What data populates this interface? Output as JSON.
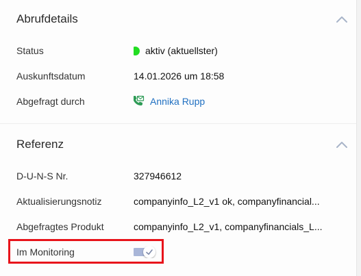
{
  "colors": {
    "status_active": "#22dd22",
    "link": "#1f6fc1",
    "highlight": "#e8141b",
    "toggle_track": "#a9b6d8",
    "toggle_check": "#7d88a8",
    "phone_icon": "#2e9b56"
  },
  "abrufdetails": {
    "title": "Abrufdetails",
    "collapse_icon": "chevron-up-icon",
    "status": {
      "label": "Status",
      "value": "aktiv (aktuellster)"
    },
    "auskunftsdatum": {
      "label": "Auskunftsdatum",
      "value": "14.01.2026 um 18:58"
    },
    "abgefragt_durch": {
      "label": "Abgefragt durch",
      "icon": "phone-email-icon",
      "value": "Annika Rupp"
    }
  },
  "referenz": {
    "title": "Referenz",
    "collapse_icon": "chevron-up-icon",
    "duns": {
      "label": "D-U-N-S Nr.",
      "value": "327946612"
    },
    "aktualisierungsnotiz": {
      "label": "Aktualisierungsnotiz",
      "value": "companyinfo_L2_v1 ok, companyfinancial..."
    },
    "abgefragtes_produkt": {
      "label": "Abgefragtes Produkt",
      "value": "companyinfo_L2_v1, companyfinancials_L..."
    },
    "im_monitoring": {
      "label": "Im Monitoring",
      "checked": true
    }
  }
}
